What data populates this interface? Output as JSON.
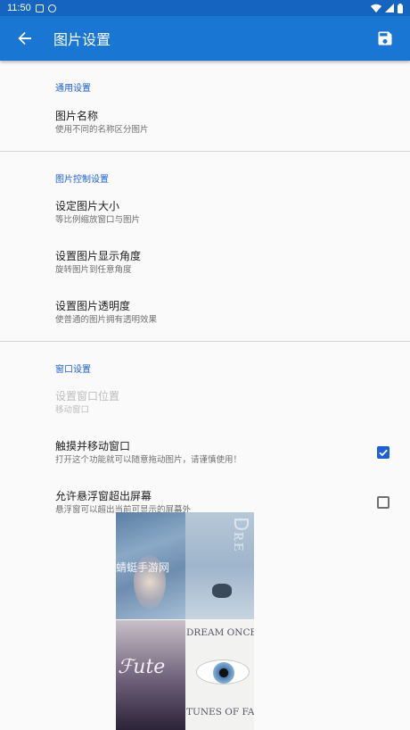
{
  "statusbar": {
    "time": "11:50"
  },
  "appbar": {
    "title": "图片设置"
  },
  "sections": {
    "general": {
      "header": "通用设置",
      "items": [
        {
          "title": "图片名称",
          "summary": "使用不同的名称区分图片"
        }
      ]
    },
    "image_control": {
      "header": "图片控制设置",
      "items": [
        {
          "title": "设定图片大小",
          "summary": "等比例缩放窗口与图片"
        },
        {
          "title": "设置图片显示角度",
          "summary": "旋转图片到任意角度"
        },
        {
          "title": "设置图片透明度",
          "summary": "使普通的图片拥有透明效果"
        }
      ]
    },
    "window": {
      "header": "窗口设置",
      "items": [
        {
          "title": "设置窗口位置",
          "summary": "移动窗口",
          "enabled": false
        },
        {
          "title": "触摸并移动窗口",
          "summary": "打开这个功能就可以随意拖动图片，请谨慎使用！",
          "checked": true
        },
        {
          "title": "允许悬浮窗超出屏幕",
          "summary": "悬浮窗可以超出当前可显示的屏幕外",
          "checked": false
        }
      ]
    }
  },
  "floating_image": {
    "watermark": "蜻蜓手游网",
    "tile_texts": [
      "DREAM ONCE AGAIN",
      "TUNES OF FANTASY"
    ]
  },
  "colors": {
    "statusbar": "#1565c0",
    "appbar": "#1976d2",
    "accent": "#1e5fd6",
    "background": "#fafafa"
  },
  "icons": {
    "back": "arrow-back-icon",
    "save": "floppy-disk-icon"
  }
}
